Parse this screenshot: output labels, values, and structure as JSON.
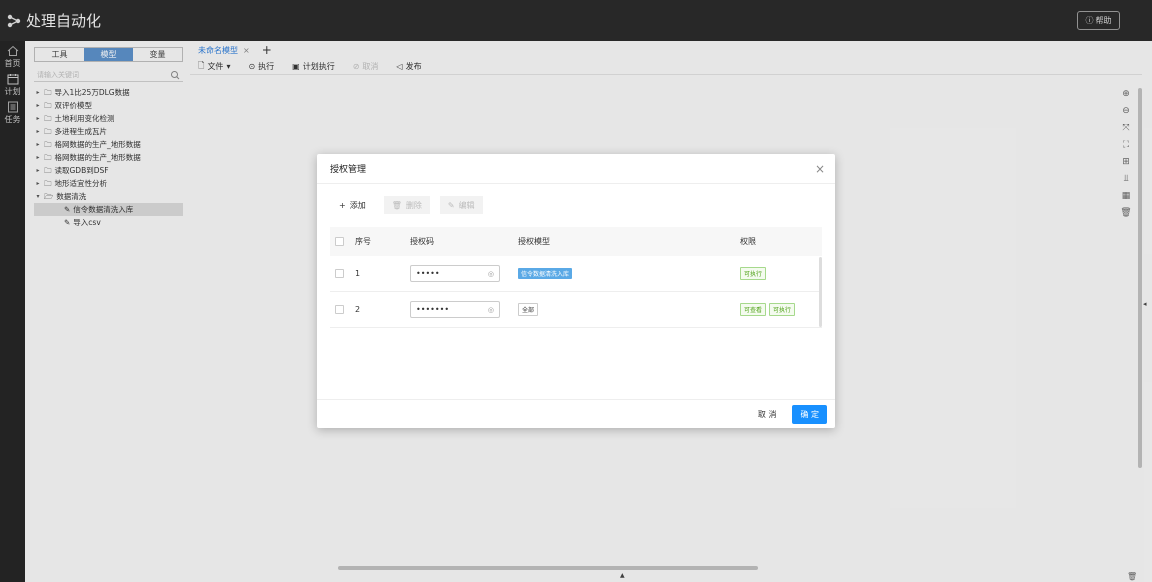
{
  "header": {
    "title": "处理自动化",
    "help_label": "帮助"
  },
  "leftbar": {
    "items": [
      {
        "label": "首页",
        "icon": "home-icon"
      },
      {
        "label": "计划",
        "icon": "calendar-icon"
      },
      {
        "label": "任务",
        "icon": "list-icon"
      }
    ]
  },
  "panel": {
    "tabs": [
      "工具",
      "模型",
      "变量"
    ],
    "active_tab": "模型",
    "search_placeholder": "请输入关键词",
    "tree": [
      {
        "label": "导入1比25万DLG数据",
        "type": "folder"
      },
      {
        "label": "双评价模型",
        "type": "folder"
      },
      {
        "label": "土地利用变化检测",
        "type": "folder"
      },
      {
        "label": "多进程生成瓦片",
        "type": "folder"
      },
      {
        "label": "格网数据的生产_地形数据",
        "type": "folder"
      },
      {
        "label": "格网数据的生产_地形数据",
        "type": "folder"
      },
      {
        "label": "读取GDB到DSF",
        "type": "folder"
      },
      {
        "label": "地形适宜性分析",
        "type": "folder"
      },
      {
        "label": "数据清洗",
        "type": "folder-open"
      },
      {
        "label": "信令数据清洗入库",
        "type": "model",
        "selected": true
      },
      {
        "label": "导入csv",
        "type": "model"
      }
    ]
  },
  "main": {
    "doc_tab": "未命名模型",
    "toolbar": {
      "file": "文件",
      "run": "执行",
      "schedule": "计划执行",
      "cancel": "取消",
      "publish": "发布"
    }
  },
  "dialog": {
    "title": "授权管理",
    "actions": {
      "add": "添加",
      "delete": "删除",
      "edit": "编辑"
    },
    "columns": [
      "序号",
      "授权码",
      "授权模型",
      "权限"
    ],
    "rows": [
      {
        "no": "1",
        "code": "•••••",
        "model": "信令数据清洗入库",
        "model_style": "blue",
        "perms": [
          "可执行"
        ]
      },
      {
        "no": "2",
        "code": "•••••••",
        "model": "全部",
        "model_style": "plain",
        "perms": [
          "可查看",
          "可执行"
        ]
      }
    ],
    "footer": {
      "cancel": "取 消",
      "ok": "确 定"
    }
  },
  "colors": {
    "header_bg": "#2b2b2b",
    "accent": "#1890ff",
    "tab_active": "#5b8fc7"
  }
}
